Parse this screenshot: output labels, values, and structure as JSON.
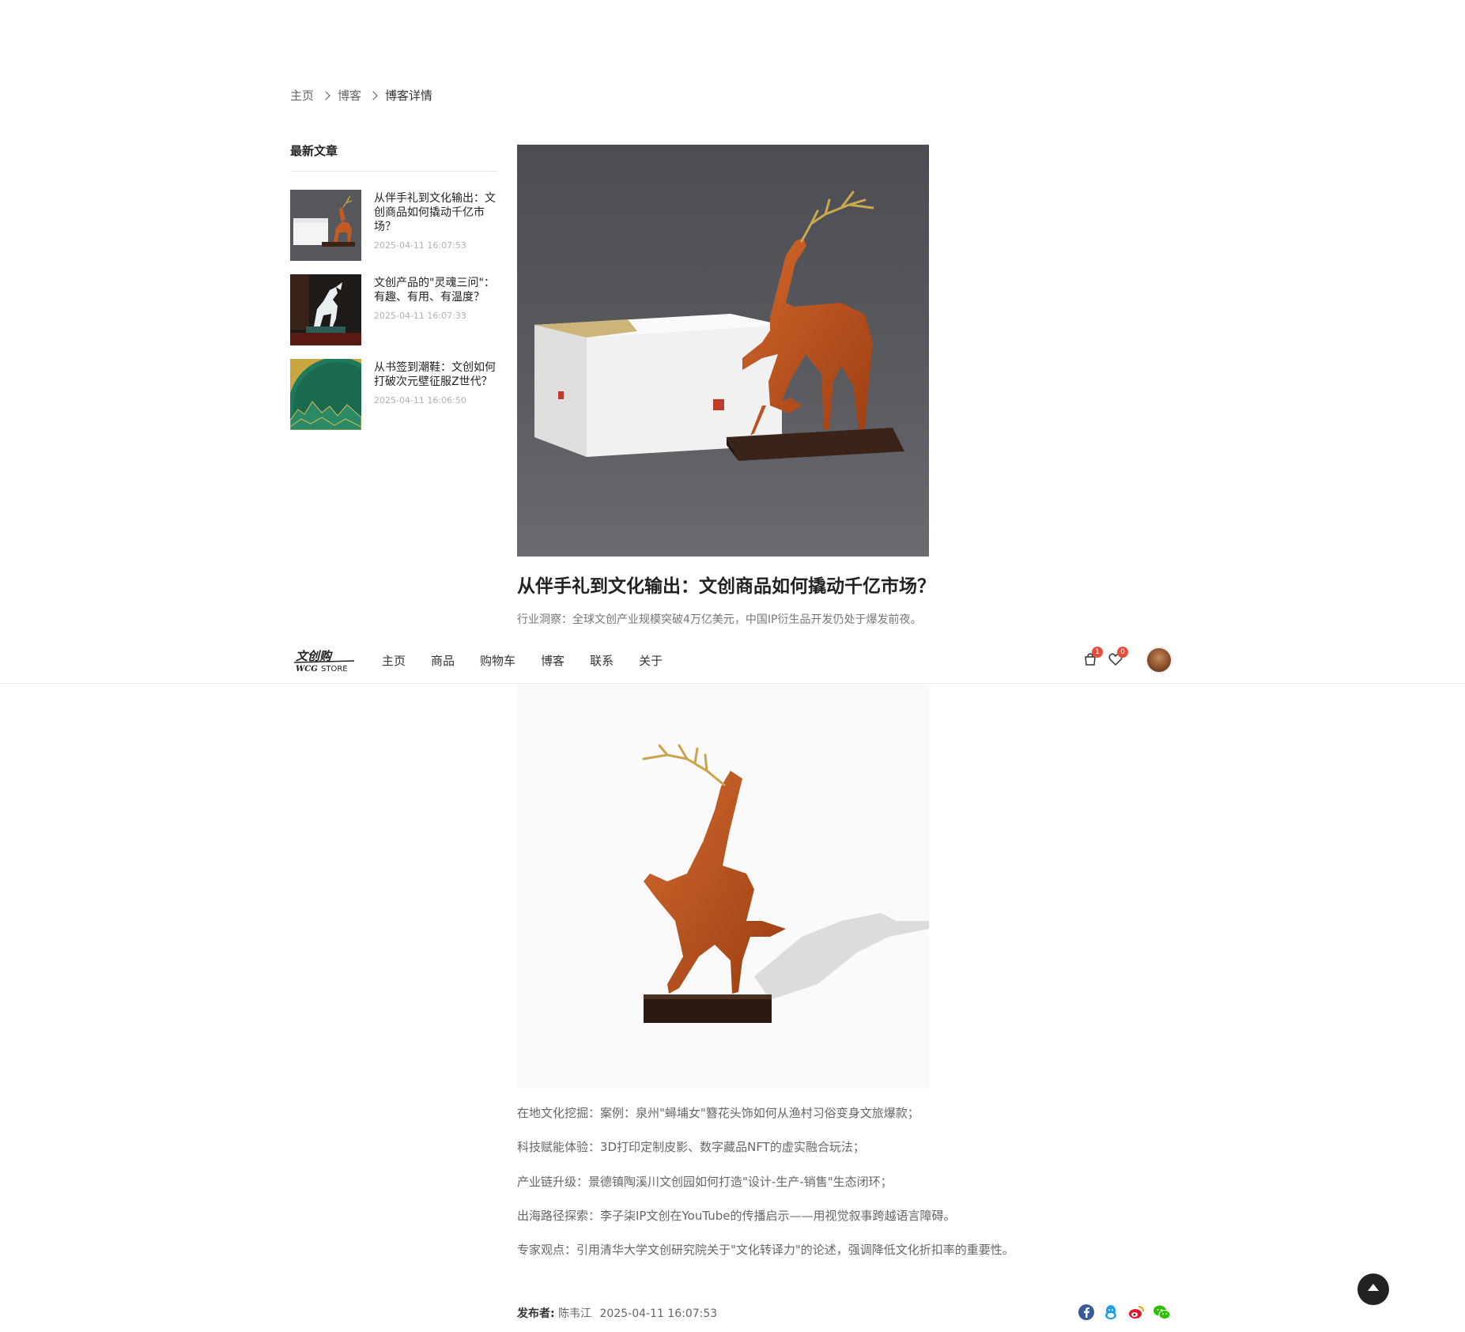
{
  "breadcrumb": {
    "home": "主页",
    "blog": "博客",
    "current": "博客详情"
  },
  "sidebar": {
    "title": "最新文章",
    "posts": [
      {
        "title": "从伴手礼到文化输出：文创商品如何撬动千亿市场？",
        "date": "2025-04-11 16:07:53"
      },
      {
        "title": "文创产品的\"灵魂三问\"：有趣、有用、有温度？",
        "date": "2025-04-11 16:07:33"
      },
      {
        "title": "从书签到潮鞋：文创如何打破次元壁征服Z世代？",
        "date": "2025-04-11 16:06:50"
      }
    ]
  },
  "article": {
    "title": "从伴手礼到文化输出：文创商品如何撬动千亿市场？",
    "subtitle": "行业洞察：全球文创产业规模突破4万亿美元，中国IP衍生品开发仍处于爆发前夜。",
    "paragraphs": [
      "在地文化挖掘：案例：泉州\"蟳埔女\"簪花头饰如何从渔村习俗变身文旅爆款；",
      "科技赋能体验：3D打印定制皮影、数字藏品NFT的虚实融合玩法；",
      "产业链升级：景德镇陶溪川文创园如何打造\"设计-生产-销售\"生态闭环；",
      "出海路径探索：李子柒IP文创在YouTube的传播启示——用视觉叙事跨越语言障碍。",
      "专家观点：引用清华大学文创研究院关于\"文化转译力\"的论述，强调降低文化折扣率的重要性。"
    ],
    "publisher_label": "发布者:",
    "publisher": "陈韦江",
    "published_at": "2025-04-11 16:07:53"
  },
  "header": {
    "logo_text": "文创购",
    "logo_sub": "STORE",
    "logo_script": "WCG",
    "nav": [
      "主页",
      "商品",
      "购物车",
      "博客",
      "联系",
      "关于"
    ],
    "cart_count": "1",
    "wishlist_count": "0"
  },
  "colors": {
    "badge": "#e74c3c",
    "facebook": "#3b5998",
    "qq": "#1ea0e6",
    "weibo": "#e6162d",
    "wechat": "#2dc100"
  },
  "share_icons": [
    "facebook-icon",
    "qq-icon",
    "weibo-icon",
    "wechat-icon"
  ]
}
